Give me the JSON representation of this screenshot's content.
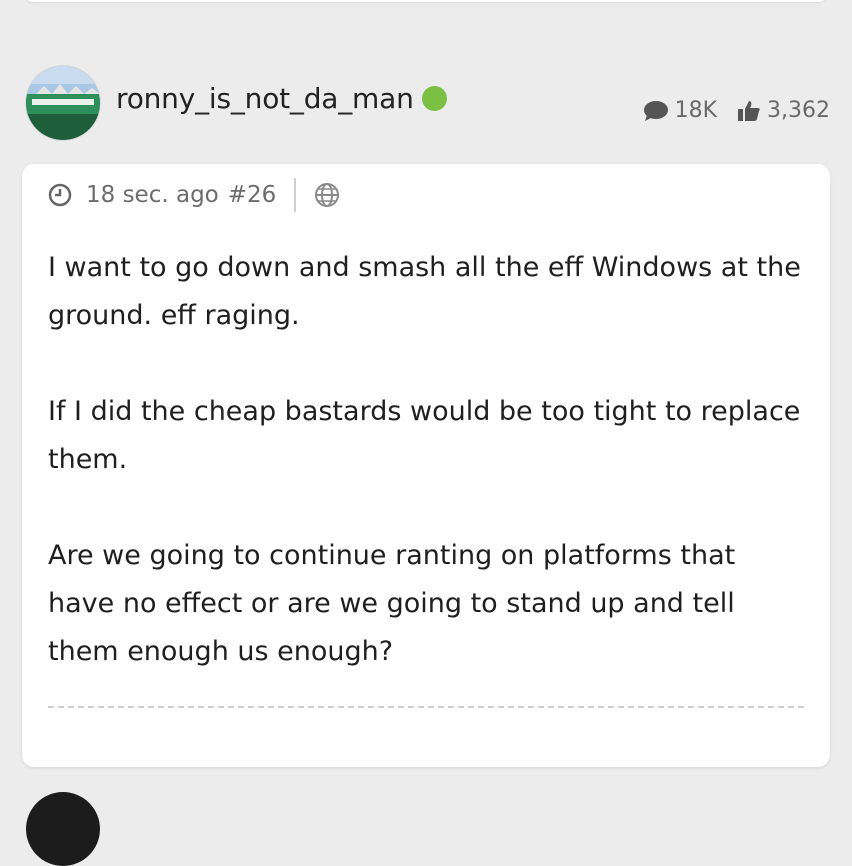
{
  "post": {
    "user": {
      "username": "ronny_is_not_da_man",
      "online_status_color": "#7cc043"
    },
    "stats": {
      "comments": "18K",
      "likes": "3,362"
    },
    "meta": {
      "time_ago": "18 sec. ago",
      "post_number": "#26"
    },
    "paragraphs": [
      "I want to go down and smash all the eff Windows at the ground. eff raging.",
      "If I did the cheap bastards would be too tight to replace them.",
      "Are we going to continue ranting on platforms that have no effect or are we going to stand up and tell them enough us enough?"
    ]
  }
}
